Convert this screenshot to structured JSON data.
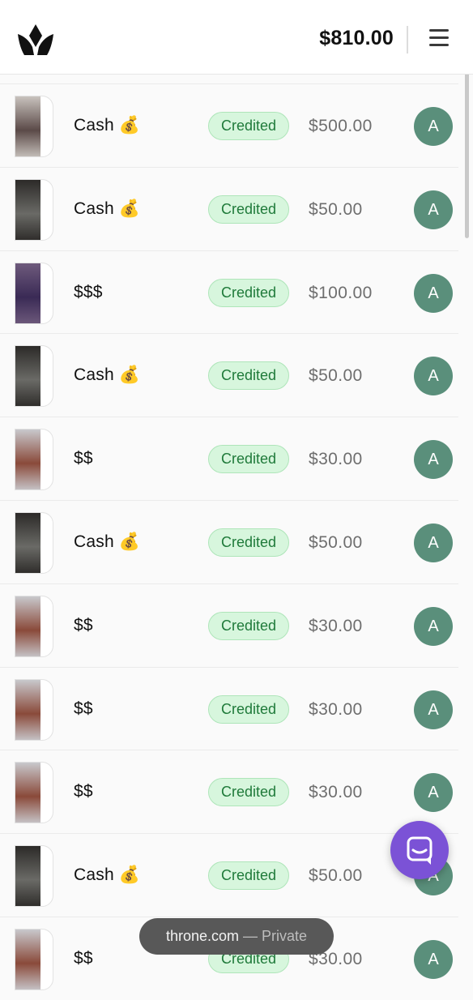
{
  "header": {
    "balance": "$810.00"
  },
  "transactions": [
    {
      "name": "Cash 💰",
      "status": "Credited",
      "amount": "$500.00",
      "avatar": "A"
    },
    {
      "name": "Cash 💰",
      "status": "Credited",
      "amount": "$50.00",
      "avatar": "A"
    },
    {
      "name": "$$$",
      "status": "Credited",
      "amount": "$100.00",
      "avatar": "A"
    },
    {
      "name": "Cash 💰",
      "status": "Credited",
      "amount": "$50.00",
      "avatar": "A"
    },
    {
      "name": "$$",
      "status": "Credited",
      "amount": "$30.00",
      "avatar": "A"
    },
    {
      "name": "Cash 💰",
      "status": "Credited",
      "amount": "$50.00",
      "avatar": "A"
    },
    {
      "name": "$$",
      "status": "Credited",
      "amount": "$30.00",
      "avatar": "A"
    },
    {
      "name": "$$",
      "status": "Credited",
      "amount": "$30.00",
      "avatar": "A"
    },
    {
      "name": "$$",
      "status": "Credited",
      "amount": "$30.00",
      "avatar": "A"
    },
    {
      "name": "Cash 💰",
      "status": "Credited",
      "amount": "$50.00",
      "avatar": "A"
    },
    {
      "name": "$$",
      "status": "Credited",
      "amount": "$30.00",
      "avatar": "A"
    }
  ],
  "browser": {
    "domain": "throne.com",
    "mode": "— Private"
  },
  "colors": {
    "badge_bg": "#d7f6dd",
    "badge_text": "#1f7a3a",
    "avatar_bg": "#5a8f7b",
    "chat_fab": "#7b52d6"
  },
  "icons": {
    "logo": "throne-crown-logo",
    "menu": "hamburger-menu-icon",
    "chat": "chat-bubble-icon"
  }
}
